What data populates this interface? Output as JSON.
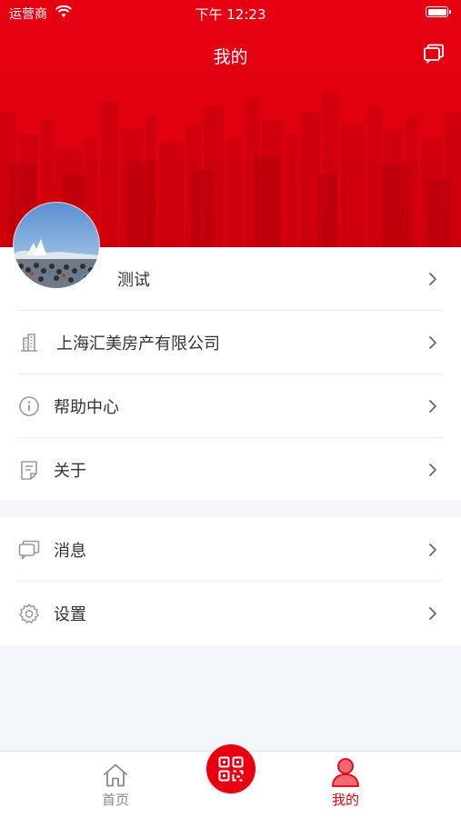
{
  "status_bar": {
    "carrier": "运营商",
    "time": "下午 12:23"
  },
  "header": {
    "title": "我的",
    "top_right_icon": "message-icon"
  },
  "profile": {
    "name": "测试"
  },
  "menu_group_1": [
    {
      "label": "上海汇美房产有限公司",
      "icon": "building-icon"
    },
    {
      "label": "帮助中心",
      "icon": "info-icon"
    },
    {
      "label": "关于",
      "icon": "document-icon"
    }
  ],
  "menu_group_2": [
    {
      "label": "消息",
      "icon": "message-icon"
    },
    {
      "label": "设置",
      "icon": "gear-icon"
    }
  ],
  "tabbar": {
    "home_label": "首页",
    "mine_label": "我的",
    "scan_icon": "qr-code-icon",
    "active_tab": "我的"
  },
  "colors": {
    "brand_red": "#e60012",
    "inactive_tab": "#888888"
  }
}
